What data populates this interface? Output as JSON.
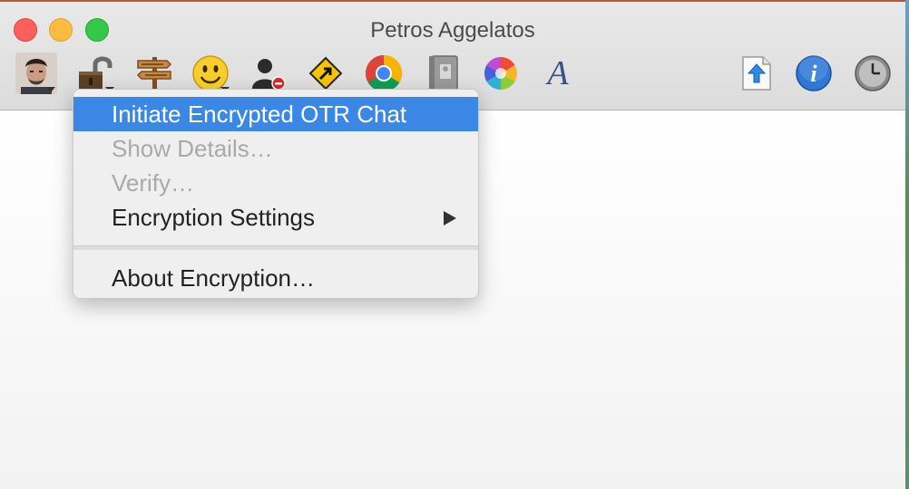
{
  "window": {
    "title": "Petros Aggelatos"
  },
  "toolbar": {
    "left_items": [
      {
        "icon": "avatar-icon",
        "has_menu": true
      },
      {
        "icon": "unlocked-padlock-icon",
        "has_menu": true
      },
      {
        "icon": "signpost-icon",
        "has_menu": false
      },
      {
        "icon": "smiley-icon",
        "has_menu": true
      },
      {
        "icon": "block-contact-icon",
        "has_menu": false
      },
      {
        "icon": "send-file-icon",
        "has_menu": false
      },
      {
        "icon": "chrome-icon",
        "has_menu": false
      },
      {
        "icon": "address-book-icon",
        "has_menu": false
      },
      {
        "icon": "color-wheel-icon",
        "has_menu": false
      },
      {
        "icon": "font-icon",
        "has_menu": false
      }
    ],
    "right_items": [
      {
        "icon": "upload-file-icon"
      },
      {
        "icon": "info-icon"
      },
      {
        "icon": "clock-icon"
      }
    ],
    "font_glyph": "A",
    "info_glyph": "i"
  },
  "encryption_menu": {
    "items": [
      {
        "label": "Initiate Encrypted OTR Chat",
        "state": "highlighted"
      },
      {
        "label": "Show Details…",
        "state": "disabled"
      },
      {
        "label": "Verify…",
        "state": "disabled"
      },
      {
        "label": "Encryption Settings",
        "state": "enabled",
        "submenu": true
      }
    ],
    "footer_items": [
      {
        "label": "About Encryption…",
        "state": "enabled"
      }
    ]
  },
  "colors": {
    "highlight": "#3a87e6",
    "close": "#fc605b",
    "minimize": "#fdbc40",
    "maximize": "#34c84a"
  }
}
